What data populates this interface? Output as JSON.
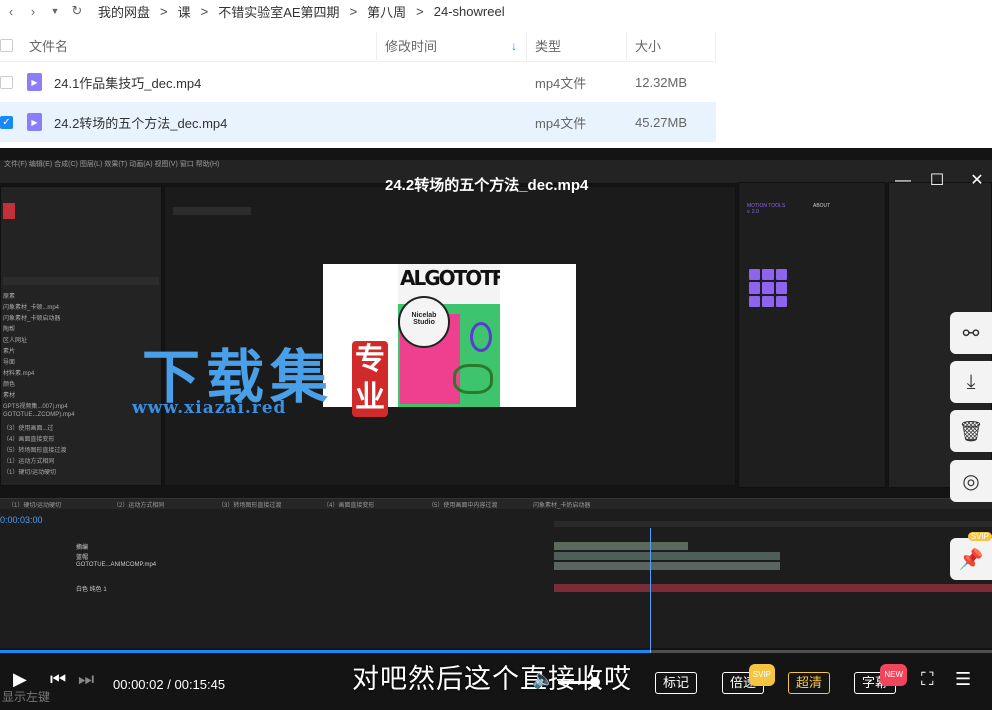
{
  "breadcrumb": [
    "我的网盘",
    "课",
    "不错实验室AE第四期",
    "第八周",
    "24-showreel"
  ],
  "table": {
    "headers": {
      "name": "文件名",
      "time": "修改时间",
      "type": "类型",
      "size": "大小"
    },
    "rows": [
      {
        "name": "24.1作品集技巧_dec.mp4",
        "type": "mp4文件",
        "size": "12.32MB",
        "selected": false
      },
      {
        "name": "24.2转场的五个方法_dec.mp4",
        "type": "mp4文件",
        "size": "45.27MB",
        "selected": true
      }
    ]
  },
  "player": {
    "title": "24.2转场的五个方法_dec.mp4",
    "current_time": "00:00:02",
    "total_time": "00:15:45",
    "time_sep": "/",
    "progress": 0.655,
    "subtitle": "对吧然后这个直接收哎",
    "buttons": {
      "mark": "标记",
      "speed": "倍速",
      "quality": "超清",
      "caption": "字幕"
    },
    "badges": {
      "speed": "SVIP",
      "caption": "NEW",
      "pin": "SVIP"
    },
    "corner": "显示左键"
  },
  "watermark": {
    "title": "下载集",
    "url": "www.xiazai.red",
    "seal": "专业"
  },
  "ae": {
    "timecode": "0:00:03:00",
    "poster_title": "ALGOTOTF",
    "poster_badge": "Nicelab Studio",
    "motion_tools": "MOTION TOOLS v. 2.0",
    "about": "ABOUT",
    "tabs": [
      "（1）硬切/运动硬切",
      "（2）运动方式相同",
      "（3）转场图形直接过渡",
      "（4）画面直接变形",
      "（5）使用画面中内容过渡",
      "闪象素材_卡奶启动器"
    ],
    "layers": [
      "摘编",
      "蓝帽",
      "GOTOTUE...ANIMCOMP.mp4",
      "白色 纯色 1"
    ],
    "menu": "文件(F)  编辑(E)  合成(C)  图层(L)  效果(T)  动画(A)  视图(V)  窗口  帮助(H)",
    "project_items": [
      "原素",
      "闪象素材_卡顿...mp4",
      "闪象素材_卡顿启动器",
      "陶帮",
      "区人网址",
      "素片",
      "导面",
      "材料素.mp4",
      "颜色",
      "素材",
      "GPTS视频集...007).mp4",
      "GOTOTUE...ZCOMP).mp4",
      "（3）使用画面...过",
      "（4）画面直接变形",
      "（5）转场图形直接过渡",
      "（1）运动方式相同",
      "（1）硬切/运动硬切"
    ]
  }
}
